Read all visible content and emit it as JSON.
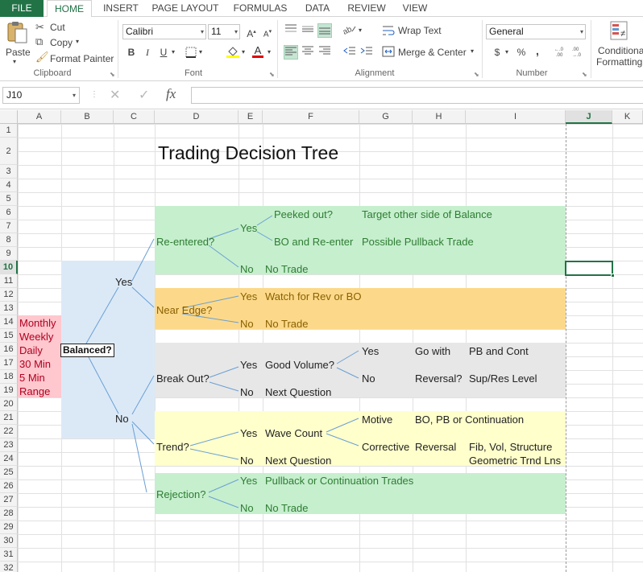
{
  "ribbon_tabs": [
    "FILE",
    "HOME",
    "INSERT",
    "PAGE LAYOUT",
    "FORMULAS",
    "DATA",
    "REVIEW",
    "VIEW"
  ],
  "clipboard": {
    "paste": "Paste",
    "cut": "Cut",
    "copy": "Copy",
    "format_painter": "Format Painter",
    "group": "Clipboard"
  },
  "font": {
    "name": "Calibri",
    "size": "11",
    "bold": "B",
    "italic": "I",
    "underline": "U",
    "group": "Font"
  },
  "alignment": {
    "wrap_text": "Wrap Text",
    "merge_center": "Merge & Center",
    "group": "Alignment"
  },
  "number": {
    "format": "General",
    "currency": "$",
    "percent": "%",
    "comma": ",",
    "group": "Number"
  },
  "styles": {
    "conditional_line1": "Conditional",
    "conditional_line2": "Formatting"
  },
  "formula_bar": {
    "name_box": "J10",
    "fx": "fx",
    "cancel": "✕",
    "enter": "✓",
    "content": ""
  },
  "columns": [
    "A",
    "B",
    "C",
    "D",
    "E",
    "F",
    "G",
    "H",
    "I",
    "J",
    "K"
  ],
  "selected_column": "J",
  "selected_row": "10",
  "rows": [
    "1",
    "2",
    "3",
    "4",
    "5",
    "6",
    "7",
    "8",
    "9",
    "10",
    "11",
    "12",
    "13",
    "14",
    "15",
    "16",
    "17",
    "18",
    "19",
    "20",
    "21",
    "22",
    "23",
    "24",
    "25",
    "26",
    "27",
    "28",
    "29",
    "30",
    "31",
    "32"
  ],
  "colors": {
    "excel_green": "#217346",
    "band_green": "#c6efce",
    "band_orange": "#fcd98a",
    "band_gray": "#e7e7e7",
    "band_yellow": "#ffffcc",
    "band_blue": "#dbe9f7",
    "band_pink": "#ffc7ce"
  },
  "sheet": {
    "title": "Trading Decision Tree",
    "timeframes": [
      "Monthly",
      "Weekly",
      "Daily",
      "30 Min",
      "5 Min",
      "Range"
    ],
    "balanced": "Balanced?",
    "yes_main": "Yes",
    "no_main": "No",
    "reentered": "Re-entered?",
    "re_yes": "Yes",
    "re_no": "No",
    "peeked_out": "Peeked out?",
    "target_other_side": "Target other side of Balance",
    "bo_reenter": "BO and Re-enter",
    "possible_pullback": "Possible Pullback Trade",
    "no_trade_1": "No Trade",
    "near_edge": "Near Edge?",
    "ne_yes": "Yes",
    "watch_rev": "Watch for Rev or BO",
    "ne_no": "No",
    "no_trade_2": "No Trade",
    "break_out": "Break Out?",
    "bo_yes": "Yes",
    "good_volume": "Good Volume?",
    "gv_yes": "Yes",
    "go_with": "Go with",
    "pb_and_cont": "PB and Cont",
    "gv_no": "No",
    "reversal_q": "Reversal?",
    "sup_res": "Sup/Res Level",
    "bo_no": "No",
    "next_question_1": "Next Question",
    "trend": "Trend?",
    "tr_yes": "Yes",
    "wave_count": "Wave Count",
    "motive": "Motive",
    "bo_pb_cont": "BO, PB or Continuation",
    "corrective": "Corrective",
    "reversal": "Reversal",
    "fib_vol": "Fib, Vol, Structure",
    "tr_no": "No",
    "next_question_2": "Next Question",
    "geometric": "Geometric Trnd Lns",
    "rejection": "Rejection?",
    "rj_yes": "Yes",
    "pullback_cont": "Pullback or Continuation Trades",
    "rj_no": "No",
    "no_trade_3": "No Trade"
  }
}
